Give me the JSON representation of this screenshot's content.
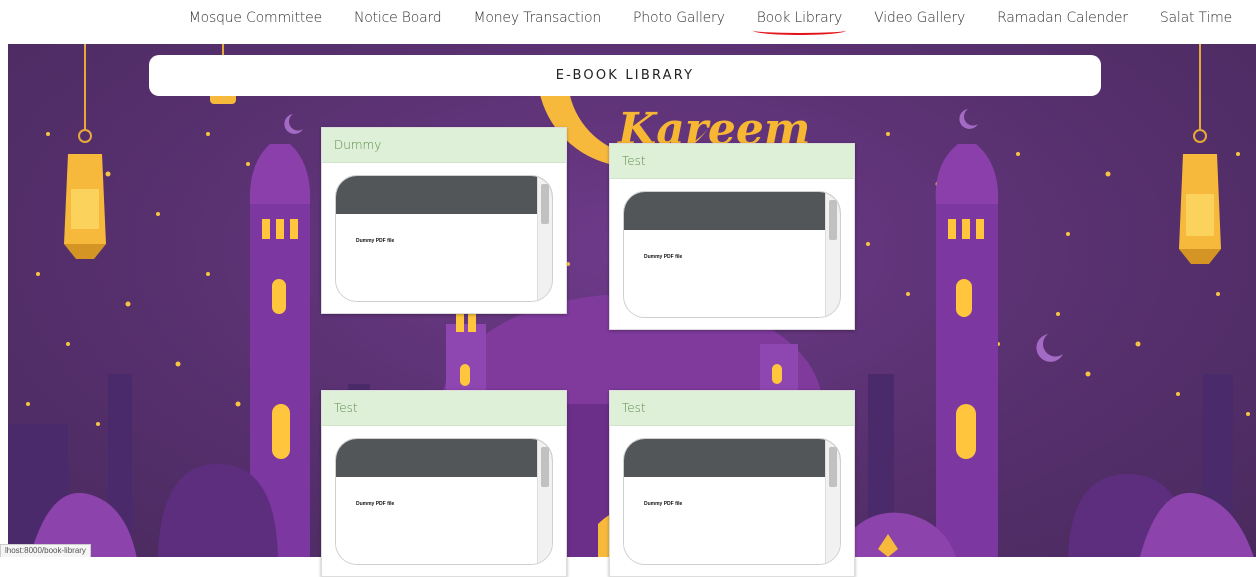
{
  "nav": {
    "items": [
      {
        "label": "Mosque Committee"
      },
      {
        "label": "Notice Board"
      },
      {
        "label": "Money Transaction"
      },
      {
        "label": "Photo Gallery"
      },
      {
        "label": "Book Library",
        "active": true
      },
      {
        "label": "Video Gallery"
      },
      {
        "label": "Ramadan Calender"
      },
      {
        "label": "Salat Time"
      }
    ]
  },
  "hero": {
    "greeting": "Kareem"
  },
  "library": {
    "title": "E-BOOK LIBRARY",
    "books": [
      {
        "name": "Dummy",
        "pdf_text": "Dummy PDF file"
      },
      {
        "name": "Test",
        "pdf_text": "Dummy PDF file"
      },
      {
        "name": "Test",
        "pdf_text": "Dummy PDF file"
      },
      {
        "name": "Test",
        "pdf_text": "Dummy PDF file"
      }
    ]
  },
  "status_bar": {
    "url": "lhost:8000/book-library"
  },
  "colors": {
    "accent_underline": "#e4141b",
    "hero_purple": "#57306e",
    "card_header": "#dff0d8",
    "lantern_gold": "#f6b93b"
  }
}
